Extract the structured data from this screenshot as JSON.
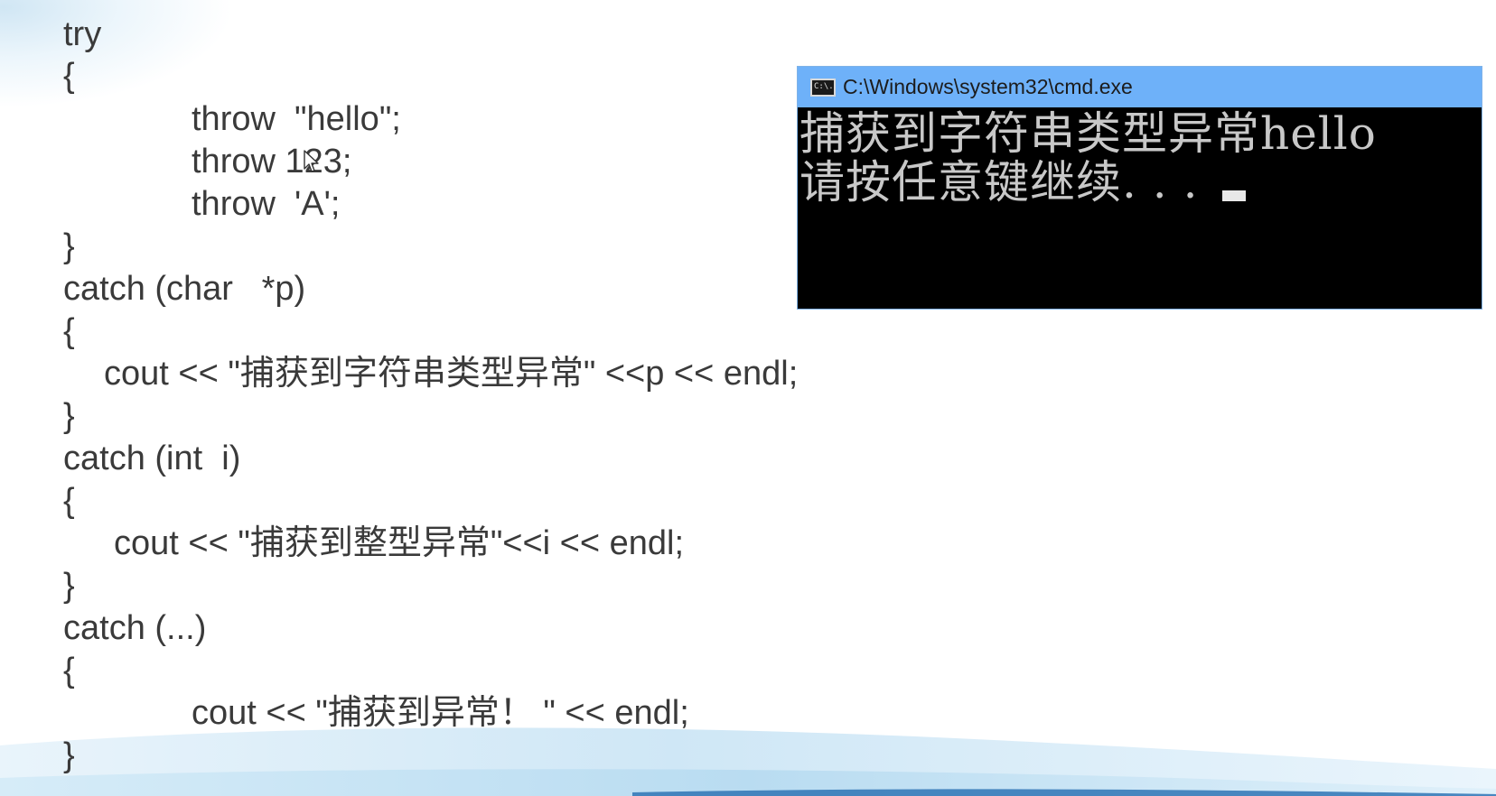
{
  "code_lines": [
    {
      "text": "try"
    },
    {
      "text": "{"
    },
    {
      "text": "throw  \"hello\";"
    },
    {
      "text": "throw 123;"
    },
    {
      "text": "throw  'A';"
    },
    {
      "text": "}"
    },
    {
      "text": "catch (char   *p)"
    },
    {
      "text": "{"
    },
    {
      "text": "cout << \"捕获到字符串类型异常\" <<p << endl;"
    },
    {
      "text": "}"
    },
    {
      "text": "catch (int  i)"
    },
    {
      "text": "{"
    },
    {
      "text": "cout << \"捕获到整型异常\"<<i << endl;"
    },
    {
      "text": "}"
    },
    {
      "text": "catch (...)"
    },
    {
      "text": "{"
    },
    {
      "text": "cout << \"捕获到异常！ \" << endl;"
    },
    {
      "text": "}"
    }
  ],
  "cmd": {
    "title": "C:\\Windows\\system32\\cmd.exe",
    "icon_text": "C:\\.",
    "output_line_1": "捕获到字符串类型异常hello",
    "output_line_2": "请按任意键继续. . . "
  },
  "colors": {
    "code_text": "#3a3a3a",
    "cmd_titlebar": "#6eb1f9",
    "cmd_background": "#000000",
    "cmd_text": "#c8c8c8"
  }
}
